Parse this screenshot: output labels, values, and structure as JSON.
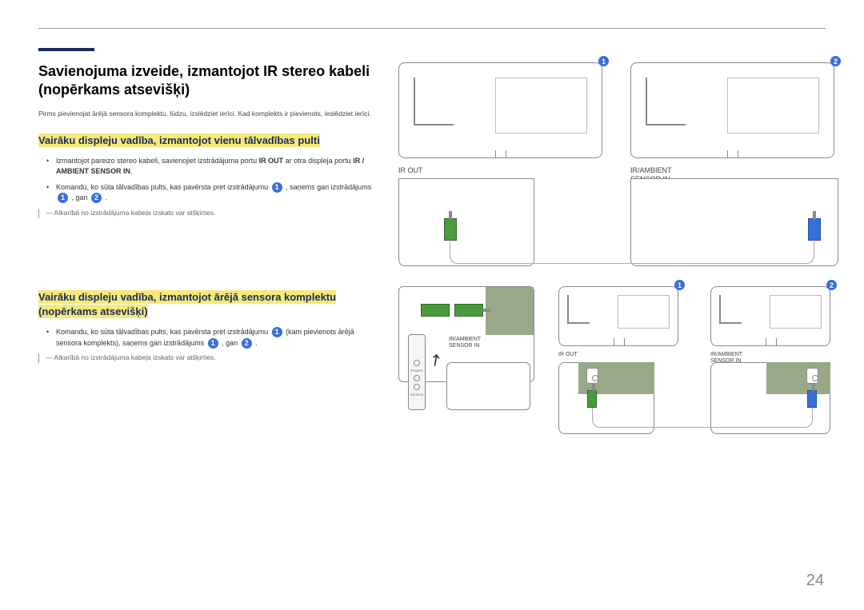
{
  "page_number": "24",
  "main_title": "Savienojuma izveide, izmantojot IR stereo kabeli (nopērkams atsevišķi)",
  "intro": "Pirms pievienojat ārējā sensora komplektu, lūdzu, izslēdziet ierīci. Kad komplekts ir pievienots, ieslēdziet ierīci.",
  "section1": {
    "heading": "Vairāku displeju vadība, izmantojot vienu tālvadības pulti",
    "bullet1_a": "Izmantojot pareizo stereo kabeli, savienojiet izstrādājuma portu ",
    "bullet1_b": "IR OUT",
    "bullet1_c": " ar otra displeja portu ",
    "bullet1_d": "IR / AMBIENT SENSOR IN",
    "bullet1_e": ".",
    "bullet2_a": "Komandu, ko sūta tālvadības pults, kas pavērsta pret izstrādājumu ",
    "bullet2_b": " , saņems gan izstrādājums ",
    "bullet2_c": " , gan ",
    "bullet2_d": " .",
    "note": "Atkarībā no izstrādājuma kabeļa izskats var atšķirties."
  },
  "section2": {
    "heading": "Vairāku displeju vadība, izmantojot ārējā sensora komplektu (nopērkams atsevišķi)",
    "bullet1_a": "Komandu, ko sūta tālvadības pults, kas pavērsta pret izstrādājumu ",
    "bullet1_b": " (kam pievienots ārējā sensora komplekts), saņems gan izstrādājums ",
    "bullet1_c": " , gan ",
    "bullet1_d": " .",
    "note": "Atkarībā no izstrādājuma kabeļa izskats var atšķirties."
  },
  "labels": {
    "ir_out": "IR OUT",
    "ir_ambient": "IR/AMBIENT",
    "sensor_in": "SENSOR IN",
    "ir_ambient_sensor_in": "IR/AMBIENT SENSOR IN",
    "power": "POWER",
    "source": "SOURCE"
  },
  "badges": {
    "one": "1",
    "two": "2"
  }
}
